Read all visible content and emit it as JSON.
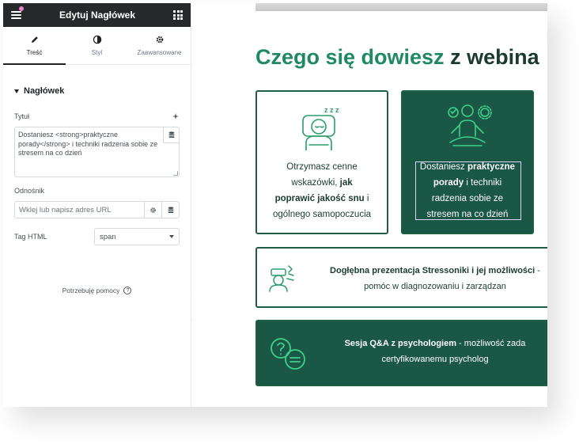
{
  "panel": {
    "title": "Edytuj Nagłówek",
    "tabs": [
      {
        "label": "Treść",
        "icon": "pencil-icon",
        "active": true
      },
      {
        "label": "Styl",
        "icon": "contrast-icon",
        "active": false
      },
      {
        "label": "Zaawansowane",
        "icon": "gear-icon",
        "active": false
      }
    ],
    "section_title": "Nagłówek",
    "title_label": "Tytuł",
    "title_value": "Dostaniesz <strong>praktyczne porady</strong> i techniki radzenia sobie ze stresem na co dzień",
    "link_label": "Odnośnik",
    "link_placeholder": "Wklej lub napisz adres URL",
    "tag_label": "Tag HTML",
    "tag_value": "span",
    "help_text": "Potrzebuję pomocy"
  },
  "preview": {
    "heading_green": "Czego się dowiesz",
    "heading_dark": " z webina",
    "card1": {
      "line1": "Otrzymasz cenne",
      "line2_pre": "wskazówki, ",
      "line2_bold": "jak",
      "line3_bold": "poprawić jakość snu",
      "line3_post": " i",
      "line4": "ogólnego samopoczucia"
    },
    "card2": {
      "line1_pre": "Dostaniesz ",
      "line1_bold": "praktyczne",
      "line2_bold": "porady",
      "line2_post": " i techniki",
      "line3": "radzenia sobie ze",
      "line4": "stresem na co dzień"
    },
    "wide1": {
      "bold": "Dogłębna prezentacja Stressoniki i jej możliwości",
      "post": " -",
      "line2": "pomóc w diagnozowaniu i zarządzan"
    },
    "wide2": {
      "bold": "Sesja Q&A z psychologiem",
      "post": " - możliwość zada",
      "line2": "certyfikowanemu psycholog"
    }
  },
  "colors": {
    "accent_green": "#1f8a62",
    "dark_green": "#1a5744",
    "panel_header": "#26292c"
  }
}
